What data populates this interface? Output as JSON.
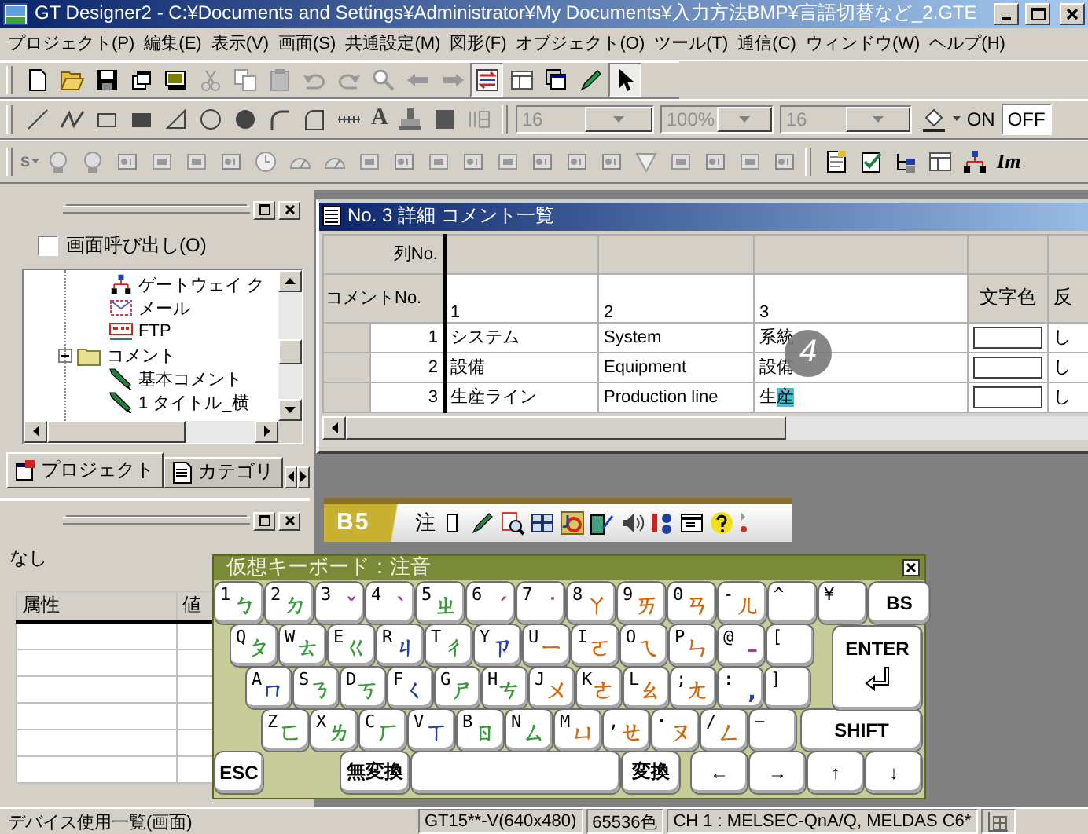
{
  "window": {
    "title": "GT Designer2 - C:¥Documents and Settings¥Administrator¥My Documents¥入力方法BMP¥言語切替など_2.GTE"
  },
  "menu": [
    "プロジェクト(P)",
    "編集(E)",
    "表示(V)",
    "画面(S)",
    "共通設定(M)",
    "図形(F)",
    "オブジェクト(O)",
    "ツール(T)",
    "通信(C)",
    "ウィンドウ(W)",
    "ヘルプ(H)"
  ],
  "figure_toolbar": {
    "text_tool": "A",
    "combos": [
      {
        "value": "16"
      },
      {
        "value": "100%"
      },
      {
        "value": "16"
      }
    ],
    "switches": [
      {
        "label": "ON",
        "selected": false
      },
      {
        "label": "OFF",
        "selected": true
      }
    ]
  },
  "object_toolbar": {
    "leading": "S",
    "label": "Im"
  },
  "project_panel": {
    "call_screen": {
      "label": "画面呼び出し(O)",
      "checked": false
    },
    "tree": [
      {
        "label": "ゲートウェイ ク",
        "kind": "network"
      },
      {
        "label": "メール",
        "kind": "mail"
      },
      {
        "label": "FTP",
        "kind": "ftp"
      },
      {
        "label": "コメント",
        "kind": "folder",
        "expanded": true,
        "children": [
          {
            "label": "基本コメント",
            "kind": "comment"
          },
          {
            "label": "1 タイトル_横",
            "kind": "comment"
          }
        ]
      }
    ],
    "tabs": [
      {
        "label": "プロジェクト",
        "selected": true
      },
      {
        "label": "カテゴリ",
        "selected": false
      }
    ]
  },
  "property_panel": {
    "text": "なし",
    "columns": [
      "属性",
      "値"
    ]
  },
  "comment_window": {
    "title": "No. 3 詳細 コメント一覧",
    "column_no_label": "列No.",
    "comment_no_label": "コメントNo.",
    "columns": [
      "1",
      "2",
      "3",
      "文字色",
      "反"
    ],
    "rows": [
      {
        "no": "1",
        "cells": [
          "システム",
          "System",
          "系統"
        ],
        "reverse": "し"
      },
      {
        "no": "2",
        "cells": [
          "設備",
          "Equipment",
          "設備"
        ],
        "reverse": "し"
      },
      {
        "no": "3",
        "cells": [
          "生産ライン",
          "Production line",
          "生"
        ],
        "composing": "産",
        "reverse": "し"
      }
    ],
    "callout": "4"
  },
  "ime_bar": {
    "mode": "B5",
    "label": "注"
  },
  "keyboard": {
    "title": "仮想キーボード：注音",
    "rows": [
      [
        {
          "kind": "char",
          "label": "1",
          "zhuyin": "ㄅ",
          "color": "#3a9a3a"
        },
        {
          "kind": "char",
          "label": "2",
          "zhuyin": "ㄉ",
          "color": "#3a9a3a"
        },
        {
          "kind": "char",
          "label": "3",
          "zhuyin": "ˇ",
          "color": "#a03ca0"
        },
        {
          "kind": "char",
          "label": "4",
          "zhuyin": "ˋ",
          "color": "#a03ca0"
        },
        {
          "kind": "char",
          "label": "5",
          "zhuyin": "ㄓ",
          "color": "#3a9a3a"
        },
        {
          "kind": "char",
          "label": "6",
          "zhuyin": "ˊ",
          "color": "#a03ca0"
        },
        {
          "kind": "char",
          "label": "7",
          "zhuyin": "˙",
          "color": "#a03ca0"
        },
        {
          "kind": "char",
          "label": "8",
          "zhuyin": "ㄚ",
          "color": "#d06a10"
        },
        {
          "kind": "char",
          "label": "9",
          "zhuyin": "ㄞ",
          "color": "#d06a10"
        },
        {
          "kind": "char",
          "label": "0",
          "zhuyin": "ㄢ",
          "color": "#d06a10"
        },
        {
          "kind": "char",
          "label": "-",
          "zhuyin": "ㄦ",
          "color": "#d06a10"
        },
        {
          "kind": "char",
          "label": "^"
        },
        {
          "kind": "char",
          "label": "¥"
        },
        {
          "kind": "bs",
          "label": "BS"
        }
      ],
      [
        {
          "kind": "char",
          "label": "Q",
          "zhuyin": "ㄆ",
          "color": "#3a9a3a"
        },
        {
          "kind": "char",
          "label": "W",
          "zhuyin": "ㄊ",
          "color": "#3a9a3a"
        },
        {
          "kind": "char",
          "label": "E",
          "zhuyin": "ㄍ",
          "color": "#3a9a3a"
        },
        {
          "kind": "char",
          "label": "R",
          "zhuyin": "ㄐ",
          "color": "#2840a0"
        },
        {
          "kind": "char",
          "label": "T",
          "zhuyin": "ㄔ",
          "color": "#3a9a3a"
        },
        {
          "kind": "char",
          "label": "Y",
          "zhuyin": "ㄗ",
          "color": "#2840a0"
        },
        {
          "kind": "char",
          "label": "U",
          "zhuyin": "ㄧ",
          "color": "#d06a10"
        },
        {
          "kind": "char",
          "label": "I",
          "zhuyin": "ㄛ",
          "color": "#d06a10"
        },
        {
          "kind": "char",
          "label": "O",
          "zhuyin": "ㄟ",
          "color": "#d06a10"
        },
        {
          "kind": "char",
          "label": "P",
          "zhuyin": "ㄣ",
          "color": "#d06a10"
        },
        {
          "kind": "char",
          "label": "@",
          "zhuyin": "–",
          "color": "#a03ca0"
        },
        {
          "kind": "char",
          "label": "["
        }
      ],
      [
        {
          "kind": "char",
          "label": "A",
          "zhuyin": "ㄇ",
          "color": "#2840a0"
        },
        {
          "kind": "char",
          "label": "S",
          "zhuyin": "ㄋ",
          "color": "#3a9a3a"
        },
        {
          "kind": "char",
          "label": "D",
          "zhuyin": "ㄎ",
          "color": "#3a9a3a"
        },
        {
          "kind": "char",
          "label": "F",
          "zhuyin": "ㄑ",
          "color": "#2840a0"
        },
        {
          "kind": "char",
          "label": "G",
          "zhuyin": "ㄕ",
          "color": "#3a9a3a"
        },
        {
          "kind": "char",
          "label": "H",
          "zhuyin": "ㄘ",
          "color": "#3a9a3a"
        },
        {
          "kind": "char",
          "label": "J",
          "zhuyin": "ㄨ",
          "color": "#d06a10"
        },
        {
          "kind": "char",
          "label": "K",
          "zhuyin": "ㄜ",
          "color": "#d06a10"
        },
        {
          "kind": "char",
          "label": "L",
          "zhuyin": "ㄠ",
          "color": "#d06a10"
        },
        {
          "kind": "char",
          "label": ";",
          "zhuyin": "ㄤ",
          "color": "#d06a10"
        },
        {
          "kind": "char",
          "label": ":",
          "zhuyin": ",",
          "color": "#2840a0"
        },
        {
          "kind": "char",
          "label": "]"
        }
      ],
      [
        {
          "kind": "char",
          "label": "Z",
          "zhuyin": "ㄈ",
          "color": "#3a9a3a"
        },
        {
          "kind": "char",
          "label": "X",
          "zhuyin": "ㄌ",
          "color": "#3a9a3a"
        },
        {
          "kind": "char",
          "label": "C",
          "zhuyin": "ㄏ",
          "color": "#3a9a3a"
        },
        {
          "kind": "char",
          "label": "V",
          "zhuyin": "ㄒ",
          "color": "#2840a0"
        },
        {
          "kind": "char",
          "label": "B",
          "zhuyin": "ㄖ",
          "color": "#3a9a3a"
        },
        {
          "kind": "char",
          "label": "N",
          "zhuyin": "ㄙ",
          "color": "#3a9a3a"
        },
        {
          "kind": "char",
          "label": "M",
          "zhuyin": "ㄩ",
          "color": "#d06a10"
        },
        {
          "kind": "char",
          "label": ",",
          "zhuyin": "ㄝ",
          "color": "#d06a10"
        },
        {
          "kind": "char",
          "label": "･",
          "zhuyin": "ㄡ",
          "color": "#d06a10"
        },
        {
          "kind": "char",
          "label": "/",
          "zhuyin": "ㄥ",
          "color": "#d06a10"
        },
        {
          "kind": "char",
          "label": "−"
        },
        {
          "kind": "shift",
          "label": "SHIFT"
        }
      ]
    ],
    "bottom_row": [
      {
        "kind": "esc",
        "label": "ESC"
      },
      {
        "kind": "muhenkan",
        "label": "無変換"
      },
      {
        "kind": "space"
      },
      {
        "kind": "henkan",
        "label": "変換"
      },
      {
        "kind": "arrow",
        "label": "←"
      },
      {
        "kind": "arrow",
        "label": "→"
      },
      {
        "kind": "arrow",
        "label": "↑"
      },
      {
        "kind": "arrow",
        "label": "↓"
      }
    ],
    "enter_key": {
      "label": "ENTER"
    }
  },
  "status_bar": [
    "デバイス使用一覧(画面)",
    "GT15**-V(640x480)",
    "65536色",
    "CH 1 : MELSEC-QnA/Q, MELDAS C6*"
  ]
}
